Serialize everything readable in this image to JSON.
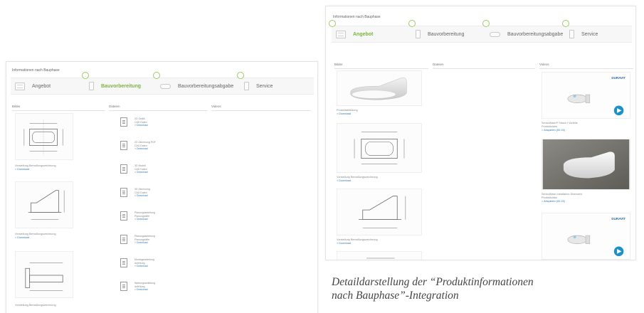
{
  "left": {
    "breadcrumb": "Informationen nach Bauphase",
    "tabs": [
      {
        "label": "Angebot",
        "icon": "grid-icon",
        "active": false
      },
      {
        "label": "Bauvorbereitung",
        "icon": "document-icon",
        "active": true
      },
      {
        "label": "Bauvorbereitungsabgabe",
        "icon": "cloud-icon",
        "active": false
      },
      {
        "label": "Service",
        "icon": "document-icon",
        "active": false
      }
    ],
    "columns": [
      "Bilder",
      "Dateien",
      "Videos"
    ],
    "images": [
      {
        "caption": "Vorstellung Bemaßungszeichnung",
        "link": "> Download"
      },
      {
        "caption": "Vorstellung Bemaßungszeichnung",
        "link": "> Download"
      },
      {
        "caption": "Vorstellung Bemaßungszeichnung",
        "link": ""
      }
    ],
    "files": [
      {
        "title": "2D Grafik",
        "meta": "CAD Daten",
        "link": "> Download"
      },
      {
        "title": "2D Zeichnung PDF",
        "meta": "CAD Daten",
        "link": "> Download"
      },
      {
        "title": "3D Modell",
        "meta": "CAD Daten",
        "link": "> Download"
      },
      {
        "title": "3D Zeichnung",
        "meta": "CAD Daten",
        "link": "> Download"
      },
      {
        "title": "Planungsanleitung",
        "meta": "Planungshilfe",
        "link": "> Download"
      },
      {
        "title": "Planungsanleitung",
        "meta": "Planungshilfe",
        "link": "> Download"
      },
      {
        "title": "Montageanleitung",
        "meta": "Anleitung",
        "link": "> Download"
      },
      {
        "title": "Wartungsanleitung",
        "meta": "Anleitung",
        "link": "> Download"
      }
    ]
  },
  "right": {
    "breadcrumb": "Informationen nach Bauphase",
    "tabs": [
      {
        "label": "Angebot",
        "icon": "grid-icon",
        "active": true
      },
      {
        "label": "Bauvorbereitung",
        "icon": "document-icon",
        "active": false
      },
      {
        "label": "Bauvorbereitungsabgabe",
        "icon": "cloud-icon",
        "active": false
      },
      {
        "label": "Service",
        "icon": "document-icon",
        "active": false
      }
    ],
    "columns": [
      "Bilder",
      "Dateien",
      "Videos"
    ],
    "images": [
      {
        "caption": "Produktabbildung",
        "link": "> Download"
      },
      {
        "caption": "Vorstellung Bemaßungszeichnung",
        "link": "> Download"
      },
      {
        "caption": "Vorstellung Bemaßungszeichnung",
        "link": "> Download"
      }
    ],
    "videos": [
      {
        "caption": "SensoWash® Starck f Vorteile",
        "meta": "Produktvideo",
        "link": "> Abspielen (00:15)"
      },
      {
        "caption": "SensoWash Installation Übersicht",
        "meta": "Produktvideo",
        "link": "> Abspielen (00:15)"
      },
      {
        "caption": "",
        "meta": "",
        "link": ""
      }
    ],
    "brand_label": "DURAVIT"
  },
  "caption": {
    "line1": "Detaildarstellung der “Produktinformationen",
    "line2": "nach Bauphase”-Integration"
  },
  "colors": {
    "accent": "#7cb342",
    "link": "#2f7ab8",
    "video_badge": "#1e90c8"
  }
}
